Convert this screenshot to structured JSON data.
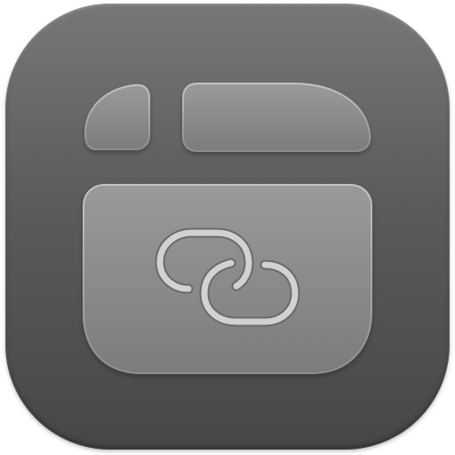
{
  "app": {
    "icon_name": "frame-link-app-icon",
    "icon_kind": "monochrome macOS-style squircle",
    "colors": {
      "background_top": "#777777",
      "background_bottom": "#474747",
      "tile_fill": "#8a8a8a",
      "tile_highlight": "#b8b8b8",
      "link_stroke": "#d2d2d2"
    },
    "glyphs": [
      "small-tab-icon",
      "wide-tab-icon",
      "content-panel-icon",
      "chain-link-icon"
    ]
  }
}
